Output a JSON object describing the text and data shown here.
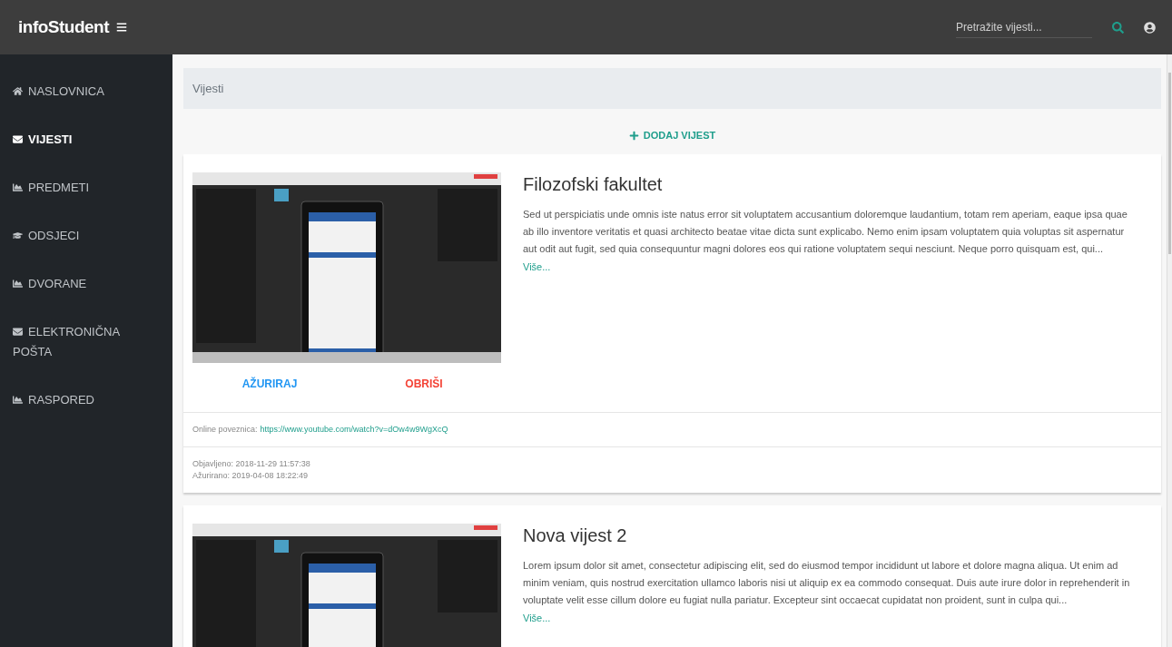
{
  "topbar": {
    "brand": "infoStudent",
    "search": {
      "placeholder": "Pretražite vijesti..."
    }
  },
  "sidebar": {
    "items": [
      {
        "label": "NASLOVNICA",
        "kind": "home",
        "selected": false
      },
      {
        "label": "VIJESTI",
        "kind": "mail",
        "selected": true
      },
      {
        "label": "PREDMETI",
        "kind": "chart",
        "selected": false
      },
      {
        "label": "ODSJECI",
        "kind": "school",
        "selected": false
      },
      {
        "label": "DVORANE",
        "kind": "chart",
        "selected": false
      },
      {
        "label": "ELEKTRONIČNA POŠTA",
        "kind": "mail",
        "selected": false
      },
      {
        "label": "RASPORED",
        "kind": "chart",
        "selected": false
      }
    ]
  },
  "page_header": "Vijesti",
  "add_button": "DODAJ VIJEST",
  "news": [
    {
      "title": "Filozofski fakultet",
      "text": "Sed ut perspiciatis unde omnis iste natus error sit voluptatem accusantium doloremque laudantium, totam rem aperiam, eaque ipsa quae ab illo inventore veritatis et quasi architecto beatae vitae dicta sunt explicabo. Nemo enim ipsam voluptatem quia voluptas sit aspernatur aut odit aut fugit, sed quia consequuntur magni dolores eos qui ratione voluptatem sequi nesciunt. Neque porro quisquam est, qui...",
      "more": "Više...",
      "actions": [
        "AŽURIRAJ",
        "OBRIŠI"
      ],
      "link_label": "Online poveznica:",
      "link": "https://www.youtube.com/watch?v=dOw4w9WgXcQ",
      "published": "Objavljeno: 2018-11-29 11:57:38",
      "updated": "Ažurirano: 2019-04-08 18:22:49"
    },
    {
      "title": "Nova vijest 2",
      "text": "Lorem ipsum dolor sit amet, consectetur adipiscing elit, sed do eiusmod tempor incididunt ut labore et dolore magna aliqua. Ut enim ad minim veniam, quis nostrud exercitation ullamco laboris nisi ut aliquip ex ea commodo consequat. Duis aute irure dolor in reprehenderit in voluptate velit esse cillum dolore eu fugiat nulla pariatur. Excepteur sint occaecat cupidatat non proident, sunt in culpa qui...",
      "more": "Više..."
    }
  ]
}
